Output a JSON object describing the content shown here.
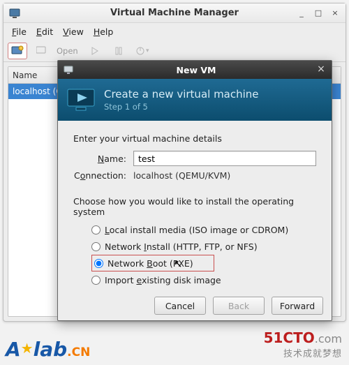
{
  "window": {
    "title": "Virtual Machine Manager",
    "controls": {
      "minimize": "_",
      "maximize": "□",
      "close": "×"
    }
  },
  "menubar": {
    "file": "File",
    "file_key": "F",
    "edit": "Edit",
    "edit_key": "E",
    "view": "View",
    "view_key": "V",
    "help": "Help",
    "help_key": "H"
  },
  "toolbar": {
    "open": "Open"
  },
  "main": {
    "column_header": "Name",
    "row0": "localhost (C"
  },
  "dialog": {
    "title": "New VM",
    "close": "×",
    "heading": "Create a new virtual machine",
    "step": "Step 1 of 5",
    "intro": "Enter your virtual machine details",
    "name_label": "Name:",
    "name_key": "N",
    "name_value": "test",
    "conn_label": "Connection:",
    "conn_key": "o",
    "conn_value": "localhost (QEMU/KVM)",
    "choose": "Choose how you would like to install the operating system",
    "opt1": "Local install media (ISO image or CDROM)",
    "opt1_key": "L",
    "opt2": "Network Install (HTTP, FTP, or NFS)",
    "opt2_key": "I",
    "opt3": "Network Boot (PXE)",
    "opt3_key": "B",
    "opt4": "Import existing disk image",
    "opt4_key": "e",
    "selected": 3,
    "buttons": {
      "cancel": "Cancel",
      "back": "Back",
      "forward": "Forward"
    }
  },
  "watermark": {
    "left_a": "A",
    "left_star": "★",
    "left_lab": "lab",
    "left_cn": ".CN",
    "right_a": "51CTO",
    "right_b": ".com",
    "right_tag": "技术成就梦想"
  }
}
